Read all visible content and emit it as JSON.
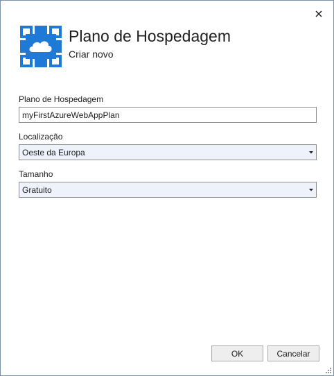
{
  "dialog": {
    "title": "Plano de Hospedagem",
    "subtitle": "Criar novo",
    "close_symbol": "✕",
    "accent_color": "#1e7ad6"
  },
  "fields": {
    "plan": {
      "label": "Plano de Hospedagem",
      "value": "myFirstAzureWebAppPlan"
    },
    "location": {
      "label": "Localização",
      "selected": "Oeste da Europa"
    },
    "size": {
      "label": "Tamanho",
      "selected": "Gratuito"
    }
  },
  "buttons": {
    "ok_label": "OK",
    "cancel_label": "Cancelar"
  },
  "icons": {
    "logo": "azure-app-service-icon",
    "close": "close-icon",
    "dropdown": "dropdown-arrow-icon",
    "grip": "resize-grip-icon"
  }
}
